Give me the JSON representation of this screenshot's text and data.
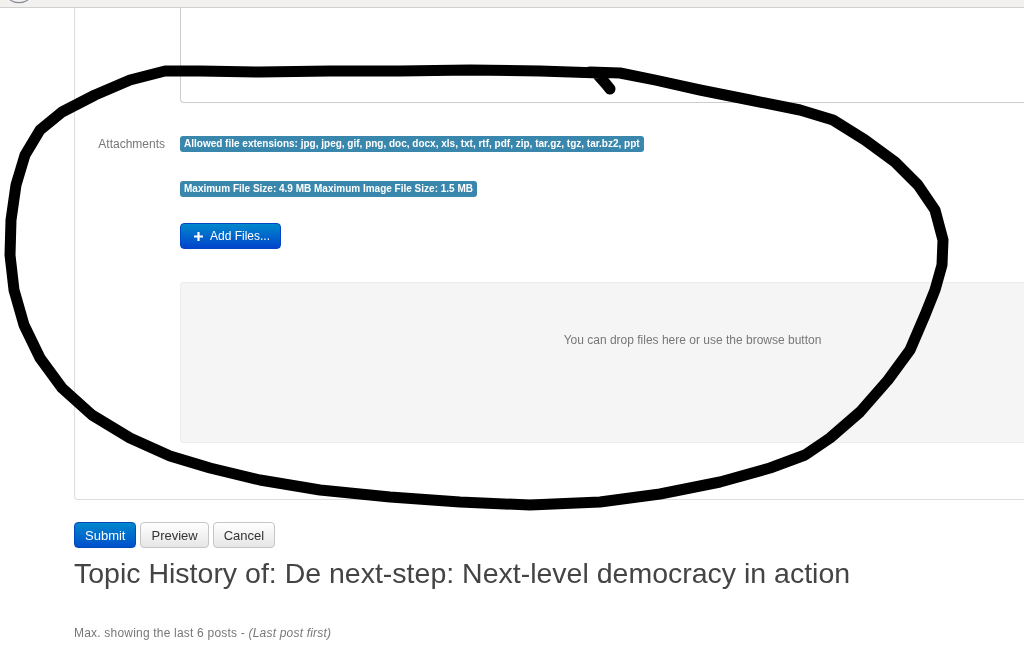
{
  "attachments": {
    "label": "Attachments",
    "notes": [
      "Allowed file extensions: jpg, jpeg, gif, png, doc, docx, xls, txt, rtf, pdf, zip, tar.gz, tgz, tar.bz2, ppt",
      "Maximum File Size: 4.9 MB Maximum Image File Size: 1.5 MB"
    ],
    "add_button": "Add Files...",
    "drop_zone": {
      "hint": "You can drop files here or use the browse button"
    }
  },
  "buttons": [
    {
      "label": "Submit",
      "kind": "primary"
    },
    {
      "label": "Preview",
      "kind": "default"
    },
    {
      "label": "Cancel",
      "kind": "default"
    }
  ],
  "topic_history": {
    "title": "Topic History of: De next-step: Next-level democracy in action",
    "note": "Max. showing the last 6 posts - *(Last post first)*"
  }
}
